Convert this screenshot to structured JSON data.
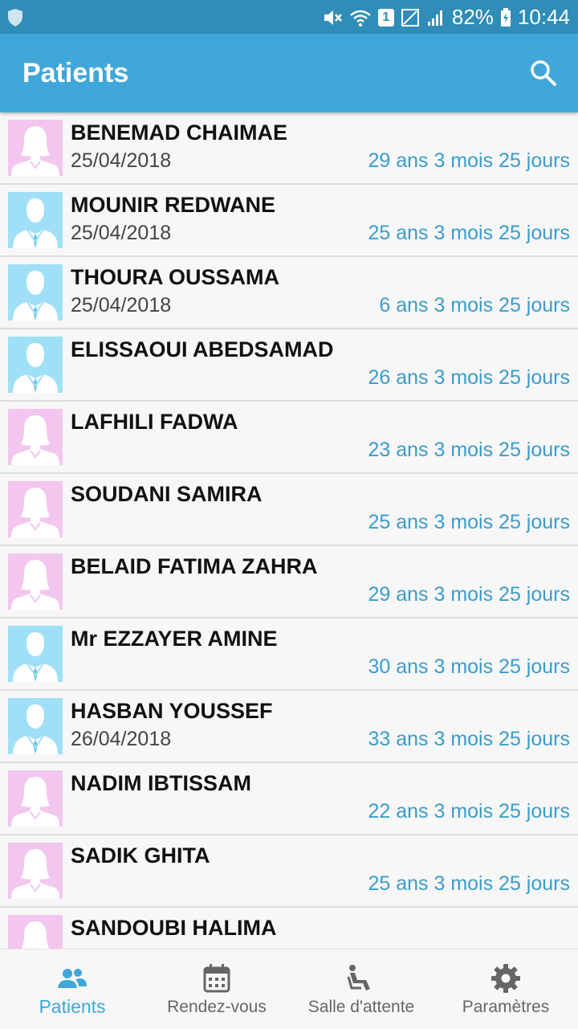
{
  "status_bar": {
    "battery": "82%",
    "time": "10:44",
    "sim_badge": "1"
  },
  "app_bar": {
    "title": "Patients"
  },
  "patients": [
    {
      "name": "BENEMAD CHAIMAE",
      "date": "25/04/2018",
      "age": "29 ans 3 mois 25 jours",
      "gender": "female"
    },
    {
      "name": "MOUNIR REDWANE",
      "date": "25/04/2018",
      "age": "25 ans 3 mois 25 jours",
      "gender": "male"
    },
    {
      "name": "THOURA OUSSAMA",
      "date": "25/04/2018",
      "age": "6 ans 3 mois 25 jours",
      "gender": "male"
    },
    {
      "name": "ELISSAOUI ABEDSAMAD",
      "date": "",
      "age": "26 ans 3 mois 25 jours",
      "gender": "male"
    },
    {
      "name": "LAFHILI FADWA",
      "date": "",
      "age": "23 ans 3 mois 25 jours",
      "gender": "female"
    },
    {
      "name": "SOUDANI SAMIRA",
      "date": "",
      "age": "25 ans 3 mois 25 jours",
      "gender": "female"
    },
    {
      "name": "BELAID FATIMA ZAHRA",
      "date": "",
      "age": "29 ans 3 mois 25 jours",
      "gender": "female"
    },
    {
      "name": "Mr EZZAYER AMINE",
      "date": "",
      "age": "30 ans 3 mois 25 jours",
      "gender": "male"
    },
    {
      "name": "HASBAN YOUSSEF",
      "date": "26/04/2018",
      "age": "33 ans 3 mois 25 jours",
      "gender": "male"
    },
    {
      "name": "NADIM IBTISSAM",
      "date": "",
      "age": "22 ans 3 mois 25 jours",
      "gender": "female"
    },
    {
      "name": "SADIK GHITA",
      "date": "",
      "age": "25 ans 3 mois 25 jours",
      "gender": "female"
    },
    {
      "name": "SANDOUBI HALIMA",
      "date": "",
      "age": "",
      "gender": "female"
    }
  ],
  "bottom_nav": [
    {
      "label": "Patients",
      "icon": "people-icon",
      "active": true
    },
    {
      "label": "Rendez-vous",
      "icon": "calendar-icon",
      "active": false
    },
    {
      "label": "Salle d'attente",
      "icon": "seat-icon",
      "active": false
    },
    {
      "label": "Paramètres",
      "icon": "gear-icon",
      "active": false
    }
  ],
  "colors": {
    "primary": "#3fa7da",
    "status_bar": "#2f8db8",
    "age_text": "#3a9ccd",
    "female_avatar_bg": "#f2c6ee",
    "male_avatar_bg": "#9fe0f6"
  }
}
